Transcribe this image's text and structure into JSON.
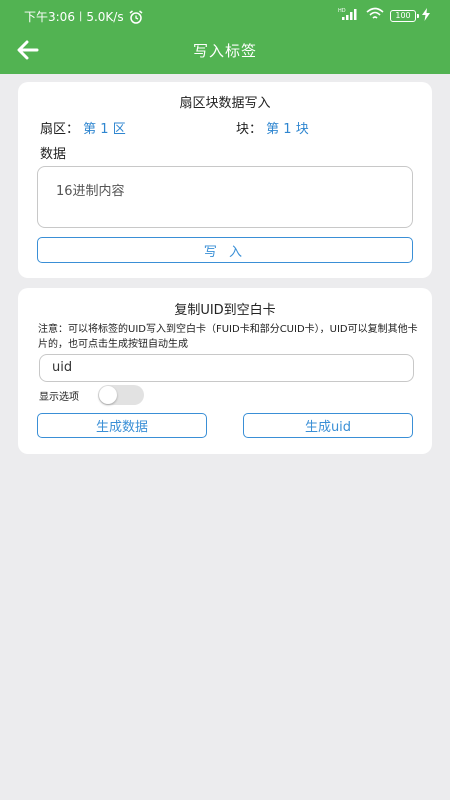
{
  "status": {
    "time": "下午3:06",
    "separator": "|",
    "speed": "5.0K/s",
    "network": "HD",
    "battery": "100"
  },
  "appbar": {
    "title": "写入标签"
  },
  "sector_card": {
    "title": "扇区块数据写入",
    "sector_label": "扇区：",
    "sector_value": "第 1 区",
    "block_label": "块：",
    "block_value": "第 1 块",
    "data_label": "数据",
    "data_placeholder": "16进制内容",
    "write_button": "写 入"
  },
  "uid_card": {
    "title": "复制UID到空白卡",
    "notice": "注意：可以将标签的UID写入到空白卡（FUID卡和部分CUID卡），UID可以复制其他卡片的，也可点击生成按钮自动生成",
    "uid_value": "uid",
    "toggle_label": "显示选项",
    "toggle_on": false,
    "gen_data_button": "生成数据",
    "gen_uid_button": "生成uid"
  },
  "colors": {
    "appbar": "#52b352",
    "accent": "#3a8fd6",
    "background": "#ececee"
  }
}
